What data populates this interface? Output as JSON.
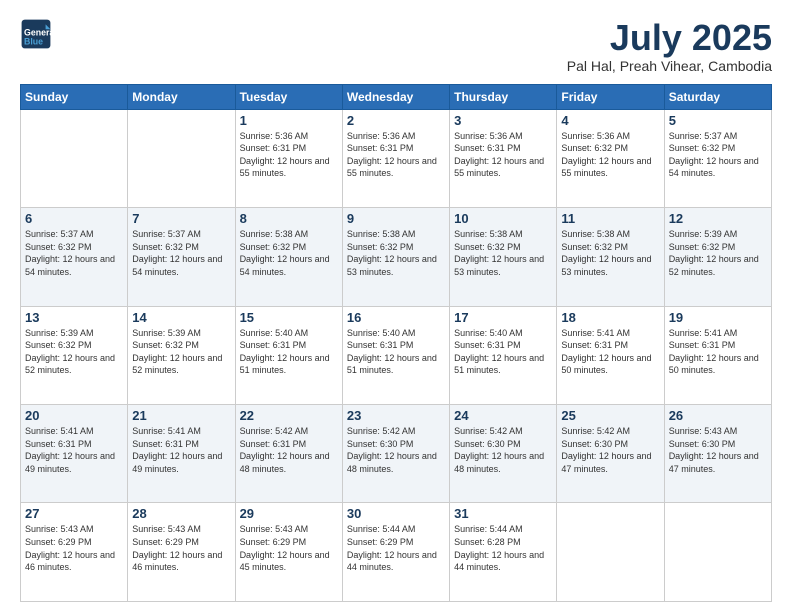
{
  "header": {
    "logo_line1": "General",
    "logo_line2": "Blue",
    "month_title": "July 2025",
    "location": "Pal Hal, Preah Vihear, Cambodia"
  },
  "weekdays": [
    "Sunday",
    "Monday",
    "Tuesday",
    "Wednesday",
    "Thursday",
    "Friday",
    "Saturday"
  ],
  "weeks": [
    [
      {
        "day": "",
        "info": ""
      },
      {
        "day": "",
        "info": ""
      },
      {
        "day": "1",
        "info": "Sunrise: 5:36 AM\nSunset: 6:31 PM\nDaylight: 12 hours and 55 minutes."
      },
      {
        "day": "2",
        "info": "Sunrise: 5:36 AM\nSunset: 6:31 PM\nDaylight: 12 hours and 55 minutes."
      },
      {
        "day": "3",
        "info": "Sunrise: 5:36 AM\nSunset: 6:31 PM\nDaylight: 12 hours and 55 minutes."
      },
      {
        "day": "4",
        "info": "Sunrise: 5:36 AM\nSunset: 6:32 PM\nDaylight: 12 hours and 55 minutes."
      },
      {
        "day": "5",
        "info": "Sunrise: 5:37 AM\nSunset: 6:32 PM\nDaylight: 12 hours and 54 minutes."
      }
    ],
    [
      {
        "day": "6",
        "info": "Sunrise: 5:37 AM\nSunset: 6:32 PM\nDaylight: 12 hours and 54 minutes."
      },
      {
        "day": "7",
        "info": "Sunrise: 5:37 AM\nSunset: 6:32 PM\nDaylight: 12 hours and 54 minutes."
      },
      {
        "day": "8",
        "info": "Sunrise: 5:38 AM\nSunset: 6:32 PM\nDaylight: 12 hours and 54 minutes."
      },
      {
        "day": "9",
        "info": "Sunrise: 5:38 AM\nSunset: 6:32 PM\nDaylight: 12 hours and 53 minutes."
      },
      {
        "day": "10",
        "info": "Sunrise: 5:38 AM\nSunset: 6:32 PM\nDaylight: 12 hours and 53 minutes."
      },
      {
        "day": "11",
        "info": "Sunrise: 5:38 AM\nSunset: 6:32 PM\nDaylight: 12 hours and 53 minutes."
      },
      {
        "day": "12",
        "info": "Sunrise: 5:39 AM\nSunset: 6:32 PM\nDaylight: 12 hours and 52 minutes."
      }
    ],
    [
      {
        "day": "13",
        "info": "Sunrise: 5:39 AM\nSunset: 6:32 PM\nDaylight: 12 hours and 52 minutes."
      },
      {
        "day": "14",
        "info": "Sunrise: 5:39 AM\nSunset: 6:32 PM\nDaylight: 12 hours and 52 minutes."
      },
      {
        "day": "15",
        "info": "Sunrise: 5:40 AM\nSunset: 6:31 PM\nDaylight: 12 hours and 51 minutes."
      },
      {
        "day": "16",
        "info": "Sunrise: 5:40 AM\nSunset: 6:31 PM\nDaylight: 12 hours and 51 minutes."
      },
      {
        "day": "17",
        "info": "Sunrise: 5:40 AM\nSunset: 6:31 PM\nDaylight: 12 hours and 51 minutes."
      },
      {
        "day": "18",
        "info": "Sunrise: 5:41 AM\nSunset: 6:31 PM\nDaylight: 12 hours and 50 minutes."
      },
      {
        "day": "19",
        "info": "Sunrise: 5:41 AM\nSunset: 6:31 PM\nDaylight: 12 hours and 50 minutes."
      }
    ],
    [
      {
        "day": "20",
        "info": "Sunrise: 5:41 AM\nSunset: 6:31 PM\nDaylight: 12 hours and 49 minutes."
      },
      {
        "day": "21",
        "info": "Sunrise: 5:41 AM\nSunset: 6:31 PM\nDaylight: 12 hours and 49 minutes."
      },
      {
        "day": "22",
        "info": "Sunrise: 5:42 AM\nSunset: 6:31 PM\nDaylight: 12 hours and 48 minutes."
      },
      {
        "day": "23",
        "info": "Sunrise: 5:42 AM\nSunset: 6:30 PM\nDaylight: 12 hours and 48 minutes."
      },
      {
        "day": "24",
        "info": "Sunrise: 5:42 AM\nSunset: 6:30 PM\nDaylight: 12 hours and 48 minutes."
      },
      {
        "day": "25",
        "info": "Sunrise: 5:42 AM\nSunset: 6:30 PM\nDaylight: 12 hours and 47 minutes."
      },
      {
        "day": "26",
        "info": "Sunrise: 5:43 AM\nSunset: 6:30 PM\nDaylight: 12 hours and 47 minutes."
      }
    ],
    [
      {
        "day": "27",
        "info": "Sunrise: 5:43 AM\nSunset: 6:29 PM\nDaylight: 12 hours and 46 minutes."
      },
      {
        "day": "28",
        "info": "Sunrise: 5:43 AM\nSunset: 6:29 PM\nDaylight: 12 hours and 46 minutes."
      },
      {
        "day": "29",
        "info": "Sunrise: 5:43 AM\nSunset: 6:29 PM\nDaylight: 12 hours and 45 minutes."
      },
      {
        "day": "30",
        "info": "Sunrise: 5:44 AM\nSunset: 6:29 PM\nDaylight: 12 hours and 44 minutes."
      },
      {
        "day": "31",
        "info": "Sunrise: 5:44 AM\nSunset: 6:28 PM\nDaylight: 12 hours and 44 minutes."
      },
      {
        "day": "",
        "info": ""
      },
      {
        "day": "",
        "info": ""
      }
    ]
  ]
}
